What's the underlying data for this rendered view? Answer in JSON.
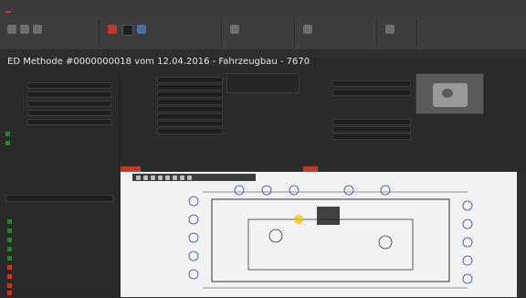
{
  "header": {
    "title": "ED Methode #0000000018 vom 12.04.2016 - Fahrzeugbau - 7670",
    "subtitle": ""
  },
  "left_panel": {
    "fields": [
      {
        "k": "",
        "v": ""
      },
      {
        "k": "",
        "v": ""
      },
      {
        "k": "",
        "v": ""
      },
      {
        "k": "",
        "v": ""
      },
      {
        "k": "",
        "v": ""
      }
    ],
    "checks": [
      {
        "label": ""
      },
      {
        "label": ""
      }
    ]
  },
  "middle_form": {
    "fields": [
      {
        "k": "",
        "v": ""
      },
      {
        "k": "",
        "v": ""
      },
      {
        "k": "",
        "v": ""
      },
      {
        "k": "",
        "v": ""
      },
      {
        "k": "",
        "v": ""
      },
      {
        "k": "",
        "v": ""
      },
      {
        "k": "",
        "v": ""
      },
      {
        "k": "",
        "v": ""
      },
      {
        "k": "",
        "v": ""
      },
      {
        "k": "",
        "v": ""
      }
    ]
  },
  "right_form": {
    "fields": [
      {
        "k": "",
        "v": ""
      },
      {
        "k": "",
        "v": ""
      },
      {
        "k": "",
        "v": ""
      },
      {
        "k": "",
        "v": ""
      },
      {
        "k": "",
        "v": ""
      }
    ]
  },
  "bottom_list": [
    {
      "label": ""
    },
    {
      "label": ""
    },
    {
      "label": ""
    },
    {
      "label": ""
    },
    {
      "label": ""
    },
    {
      "label": ""
    },
    {
      "label": ""
    },
    {
      "label": ""
    },
    {
      "label": ""
    }
  ]
}
